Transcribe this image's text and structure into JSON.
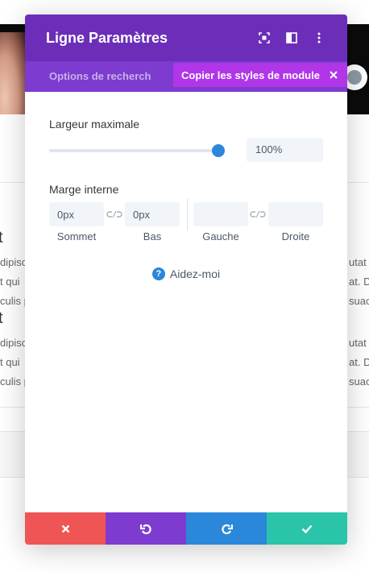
{
  "modal": {
    "title": "Ligne Paramètres",
    "tab_label": "Options de recherch",
    "copy_banner": "Copier les styles de module",
    "max_width": {
      "label": "Largeur maximale",
      "value": "100%",
      "slider_fraction": 1.0
    },
    "padding": {
      "label": "Marge interne",
      "fields": [
        {
          "name": "top",
          "value": "0px",
          "placeholder": "",
          "caption": "Sommet"
        },
        {
          "name": "bottom",
          "value": "0px",
          "placeholder": "",
          "caption": "Bas"
        },
        {
          "name": "left",
          "value": "",
          "placeholder": "",
          "caption": "Gauche"
        },
        {
          "name": "right",
          "value": "",
          "placeholder": "",
          "caption": "Droite"
        }
      ]
    },
    "help_label": "Aidez-moi",
    "help_icon_glyph": "?",
    "footer": {
      "cancel_icon": "close-icon",
      "undo_icon": "undo-icon",
      "redo_icon": "redo-icon",
      "save_icon": "check-icon"
    }
  },
  "colors": {
    "header": "#6c2eb9",
    "tabbar": "#7d3bcf",
    "copy_banner": "#b036e8",
    "accent_blue": "#2b87da",
    "cancel": "#ef5555",
    "undo": "#7e3bd0",
    "redo": "#2b87da",
    "save": "#29c4a9"
  },
  "background": {
    "heading_fragment": "t",
    "text_lines_left": [
      "dipisc",
      "t qui",
      "culis p",
      "dipisc",
      "t qui",
      "culis p"
    ],
    "text_lines_right": [
      "utat",
      "at. D",
      "suac",
      "utat",
      "at. D",
      "suac"
    ]
  }
}
